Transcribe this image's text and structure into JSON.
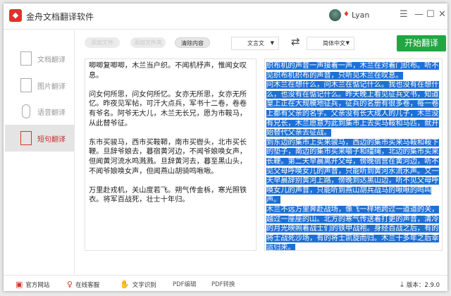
{
  "app": {
    "title": "金舟文档翻译软件",
    "user": "Lyan",
    "logo_glyph": "◆"
  },
  "window_controls": {
    "menu": "☰",
    "minimize": "—",
    "maximize": "☐",
    "close": "✕"
  },
  "sidebar": {
    "items": [
      {
        "label": "文档翻译"
      },
      {
        "label": "图片翻译"
      },
      {
        "label": "语音翻译"
      },
      {
        "label": "短句翻译",
        "active": true
      }
    ]
  },
  "toolbar": {
    "add_file": "添加文件",
    "add_folder": "添加文件夹",
    "clear": "清除内容",
    "source_lang": "文言文",
    "target_lang": "简体中文",
    "swap": "⇄",
    "start": "开始翻译"
  },
  "source_text": [
    "唧唧复唧唧，木兰当户织。不闻机杼声，惟闻女叹息。",
    "问女何所思，问女何所忆。女亦无所思，女亦无所忆。昨夜见军帖，可汗大点兵，军书十二卷，卷卷有爷名。阿爷无大儿，木兰无长兄，愿为市鞍马，从此替爷征。",
    "东市买骏马，西市买鞍鞯，南市买辔头，北市买长鞭。旦辞爷娘去，暮宿黄河边，不闻爷娘唤女声，但闻黄河流水鸣溅溅。旦辞黄河去，暮至黑山头，不闻爷娘唤女声，但闻燕山胡骑鸣啾啾。",
    "万里赴戎机，关山度若飞。朔气传金柝，寒光照铁衣。将军百战死，壮士十年归。"
  ],
  "result_text": [
    "织布机的声音一声接着一声，木兰在对着门织布。听不见织布机织布的声音，只听见木兰在叹息。",
    "问木兰在想什么，问木兰在惦记什么。我也没有在想什么，也没有在惦记什么。昨天晚上看见征兵文书，知道皇上正在大规模地征兵，征兵的名册有很多卷，每一卷上都有父亲的名字。父亲没有长大成人的儿子，木兰没有兄长，木兰愿意为此到集市上去买马鞍和马匹，就开始替代父亲去征战。",
    "到东边的集市上买来骏马，西边的集市买来马鞍和鞍下的垫子，南边的集市买来嚼子和缰绳，北边的集市买来长鞭。第二天早晨离开父母，傍晚宿营在黄河边，听不见父母呼唤女儿的声音，只能听到黄河水流水声。又一天早晨辞别黄河上路，傍晚到达黑山边，听不见父母呼唤女儿的声音，只能听到燕山胡兵战马的啾啾的鸣叫声。",
    "木兰不远万里奔赴战场，像飞一样地跨过一道道的关，越过一座座的山。北方的寒气传送着打更的声音，清冷的月光映照着战士们的铁甲战袍。身经百战之后，有的将士战死沙场，有的将士凯旋而归。木兰十多年之后幸运归来。"
  ],
  "bottom": {
    "website": "官方网站",
    "support": "在线客服",
    "ocr": "文字识别",
    "pdf_edit": "PDF编辑",
    "pdf_convert": "PDF转换",
    "version": "版本：2.9.0"
  },
  "colors": {
    "accent": "#21a643",
    "brand": "#d9362b",
    "selection": "#1e70d6"
  }
}
